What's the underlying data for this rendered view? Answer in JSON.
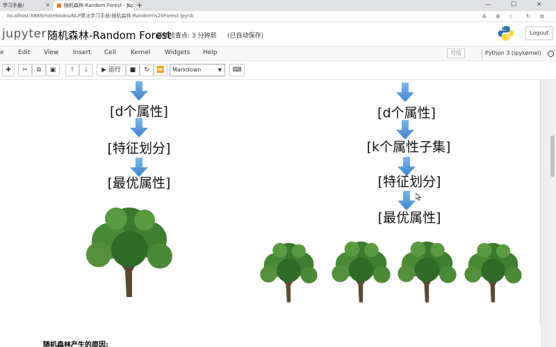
{
  "browser": {
    "tabs": [
      {
        "label": "学习手册/",
        "active": false
      },
      {
        "label": "随机森林-Random Forest - Jupyt",
        "active": true
      }
    ],
    "new_tab": "+",
    "url": "localhost:8889/notebooks/NLP算法学习手册/随机森林-Random%20Forest.ipynb"
  },
  "jupyter": {
    "logo_text": "jupyter",
    "notebook_title": "随机森林-Random Forest",
    "checkpoint": "最新检查点: 3 分钟前",
    "autosave": "(已自动保存)",
    "logout": "Logout"
  },
  "menubar": {
    "items": [
      "e",
      "Edit",
      "View",
      "Insert",
      "Cell",
      "Kernel",
      "Widgets",
      "Help"
    ],
    "trusted": "可信",
    "kernel": "Python 3 (ipykernel)"
  },
  "toolbar": {
    "run_label": "运行",
    "cell_type": "Markdown"
  },
  "content": {
    "left_flow": [
      "[d个属性]",
      "[特征划分]",
      "[最优属性]"
    ],
    "right_flow": [
      "[d个属性]",
      "[k个属性子集]",
      "[特征划分]",
      "[最优属性]"
    ],
    "bottom_text": "随机森林产生的原因:"
  },
  "colors": {
    "arrow": "#4a90d9",
    "tree_leaf": "#3d7a2f",
    "menubar_bg": "#f8f8f8"
  }
}
